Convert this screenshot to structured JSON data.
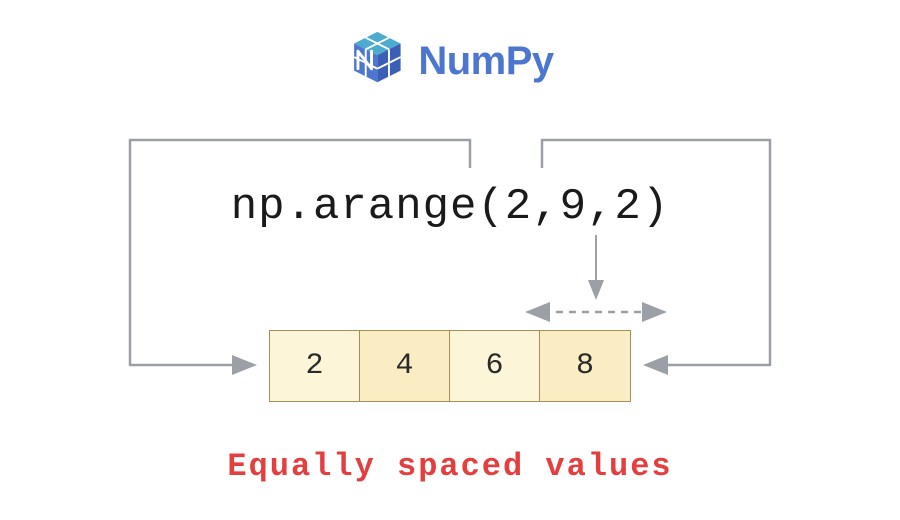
{
  "logo": {
    "brand_text": "NumPy"
  },
  "code": {
    "expression": "np.arange(2,9,2)"
  },
  "array": {
    "cells": [
      {
        "value": "2"
      },
      {
        "value": "4"
      },
      {
        "value": "6"
      },
      {
        "value": "8"
      }
    ]
  },
  "caption": {
    "text": "Equally spaced values"
  },
  "colors": {
    "brand": "#4d77cf",
    "accent": "#e53e3e",
    "cell_light": "#fdf5d8",
    "cell_dark": "#faedc4",
    "cell_border": "#a58f55",
    "wire": "#9aa0a6",
    "wire_dashed": "#9aa0a6"
  }
}
